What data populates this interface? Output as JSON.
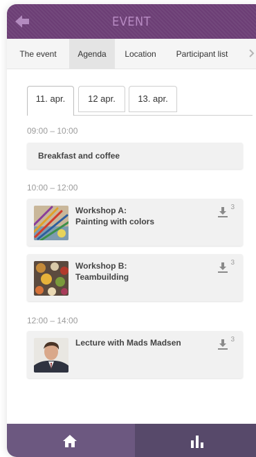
{
  "header": {
    "title": "EVENT"
  },
  "tabs": [
    {
      "label": "The event",
      "active": false
    },
    {
      "label": "Agenda",
      "active": true
    },
    {
      "label": "Location",
      "active": false
    },
    {
      "label": "Participant list",
      "active": false
    }
  ],
  "dates": [
    {
      "label": "11. apr.",
      "active": true
    },
    {
      "label": "12 apr.",
      "active": false
    },
    {
      "label": "13. apr.",
      "active": false
    }
  ],
  "agenda": [
    {
      "time": "09:00 – 10:00",
      "items": [
        {
          "title": "Breakfast and coffee"
        }
      ]
    },
    {
      "time": "10:00 – 12:00",
      "items": [
        {
          "title_line1": "Workshop A:",
          "title_line2": "Painting with colors",
          "downloads": "3"
        },
        {
          "title_line1": "Workshop B:",
          "title_line2": "Teambuilding",
          "downloads": "3"
        }
      ]
    },
    {
      "time": "12:00 – 14:00",
      "items": [
        {
          "title_line1": "Lecture with Mads Madsen",
          "downloads": "3"
        }
      ]
    }
  ],
  "colors": {
    "header": "#6c3e75",
    "header_text": "#b78ac2",
    "nav_home": "#6c5880",
    "nav_stats": "#57496a"
  },
  "icons": {
    "back": "arrow-left-icon",
    "download": "download-icon",
    "home": "home-icon",
    "stats": "bar-chart-icon"
  }
}
